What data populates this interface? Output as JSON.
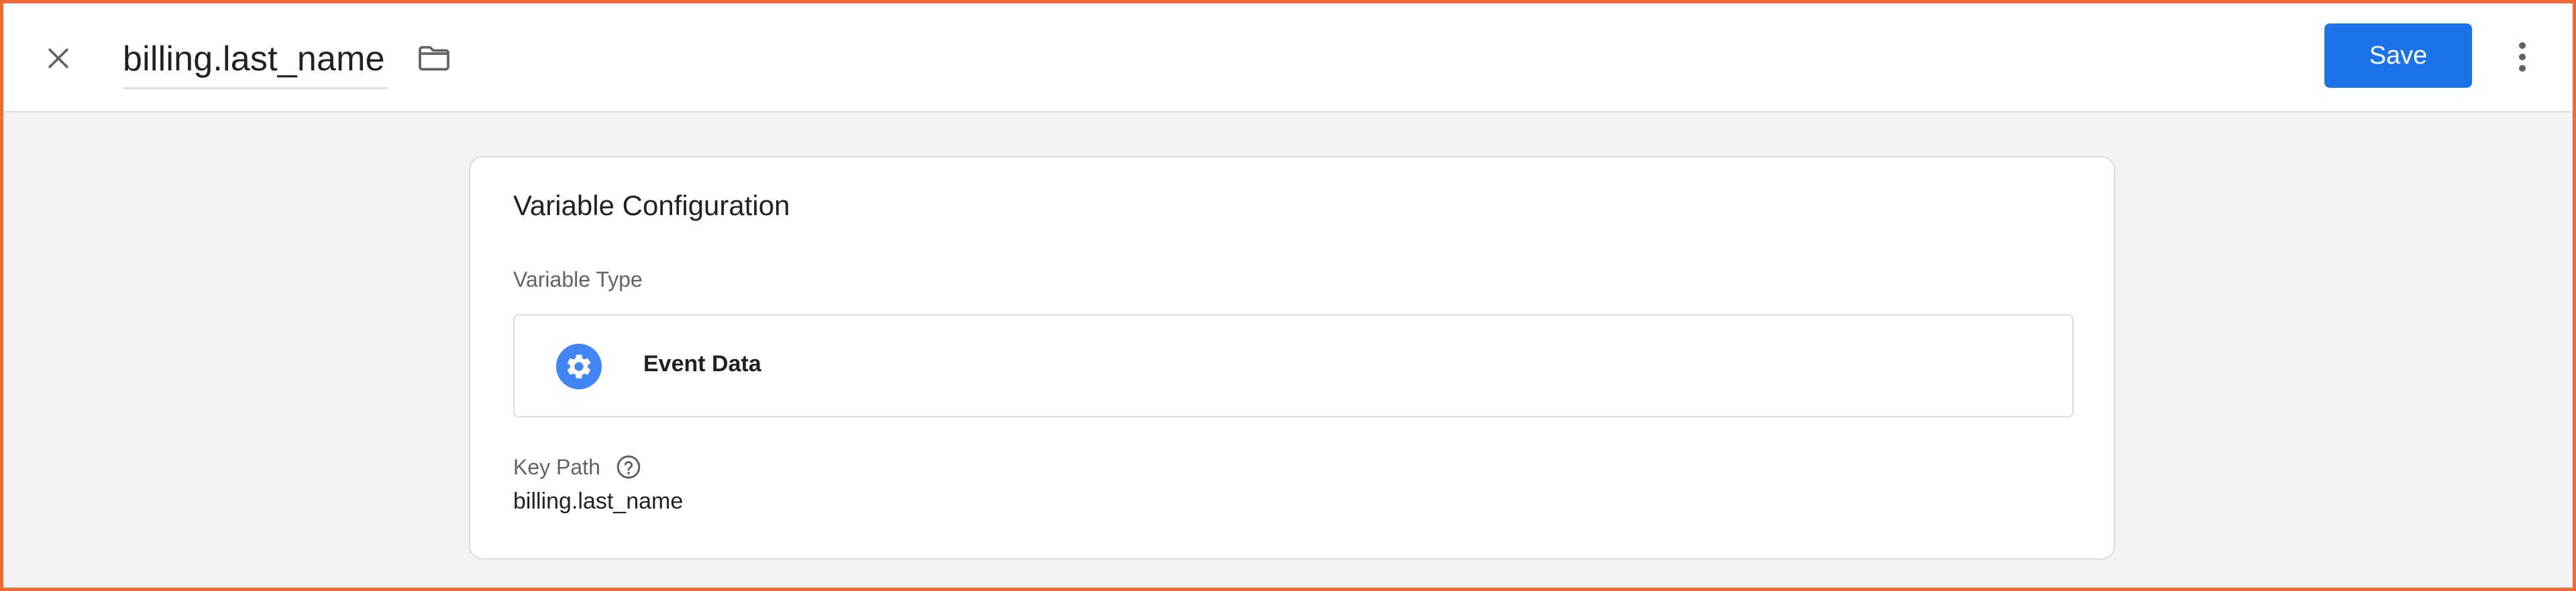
{
  "header": {
    "title": "billing.last_name",
    "save_label": "Save"
  },
  "card": {
    "title": "Variable Configuration",
    "variable_type_label": "Variable Type",
    "variable_type_value": "Event Data",
    "key_path_label": "Key Path",
    "key_path_value": "billing.last_name"
  },
  "icons": {
    "close": "close-icon",
    "folder": "folder-icon",
    "more": "more-vert-icon",
    "type": "gear-icon",
    "help": "help-icon"
  },
  "colors": {
    "accent": "#1a73e8",
    "type_icon": "#4285f4",
    "frame_border": "#f06a35"
  }
}
